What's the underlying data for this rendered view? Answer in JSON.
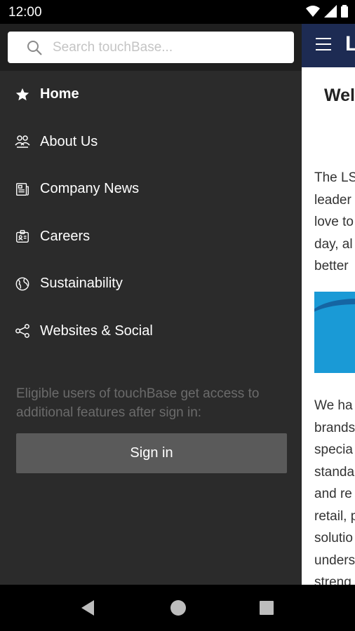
{
  "status": {
    "time": "12:00"
  },
  "search": {
    "placeholder": "Search touchBase..."
  },
  "menu": [
    {
      "label": "Home",
      "icon": "star-icon",
      "active": true
    },
    {
      "label": "About Us",
      "icon": "people-icon"
    },
    {
      "label": "Company News",
      "icon": "newspaper-icon"
    },
    {
      "label": "Careers",
      "icon": "id-badge-icon"
    },
    {
      "label": "Sustainability",
      "icon": "globe-icon"
    },
    {
      "label": "Websites & Social",
      "icon": "share-icon"
    }
  ],
  "note": "Eligible users of touchBase get access to additional features after sign in:",
  "signin_label": "Sign in",
  "page": {
    "logo": "L",
    "welcome": "Wel",
    "para1": [
      "The LS",
      "leader",
      "love to",
      "day, al",
      "better"
    ],
    "para2": [
      "We ha",
      "brands",
      "specia",
      "standa",
      "and re",
      "retail, p",
      "solutio",
      "unders",
      "streng"
    ]
  },
  "colors": {
    "appbar": "#1d2b53",
    "drawer": "#2b2b2b",
    "banner": "#1a9ad6",
    "signin": "#5a5a5a"
  }
}
